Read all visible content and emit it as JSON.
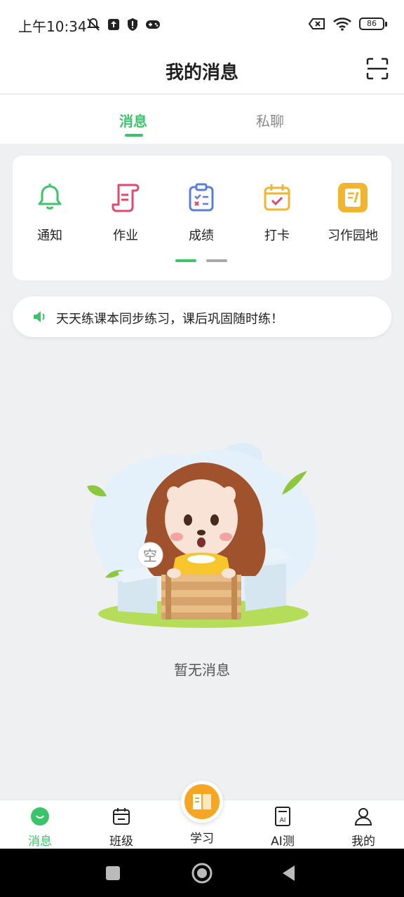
{
  "status_bar": {
    "time": "上午10:34",
    "battery": "86",
    "icons": [
      "mute-bell-icon",
      "upload-icon",
      "shield-icon",
      "gamepad-icon",
      "battery-x-icon",
      "wifi-icon",
      "battery-icon"
    ]
  },
  "header": {
    "title": "我的消息",
    "scan_icon": "scan-icon"
  },
  "tabs": [
    {
      "label": "消息",
      "active": true
    },
    {
      "label": "私聊",
      "active": false
    }
  ],
  "shortcuts": [
    {
      "label": "通知",
      "icon": "bell-icon",
      "color": "#3cc46a"
    },
    {
      "label": "作业",
      "icon": "homework-icon",
      "color": "#e2486b"
    },
    {
      "label": "成绩",
      "icon": "score-clipboard-icon",
      "color": "#5b7fd6"
    },
    {
      "label": "打卡",
      "icon": "checkin-calendar-icon",
      "color": "#f2b531"
    },
    {
      "label": "习作园地",
      "icon": "writing-icon",
      "color": "#f2b531"
    }
  ],
  "pager": {
    "pages": 2,
    "current": 1
  },
  "notice": {
    "icon": "speaker-icon",
    "text": "天天练课本同步练习，课后巩固随时练！"
  },
  "empty_state": {
    "bubble": "空",
    "text": "暂无消息"
  },
  "bottom_nav": [
    {
      "label": "消息",
      "icon": "message-icon",
      "active": true
    },
    {
      "label": "班级",
      "icon": "class-calendar-icon",
      "active": false
    },
    {
      "label": "学习",
      "icon": "book-icon",
      "active": false
    },
    {
      "label": "AI测",
      "icon": "ai-test-icon",
      "active": false
    },
    {
      "label": "我的",
      "icon": "profile-icon",
      "active": false
    }
  ],
  "colors": {
    "accent": "#3cc46a",
    "orange": "#f6a623",
    "background": "#eef0f2"
  }
}
